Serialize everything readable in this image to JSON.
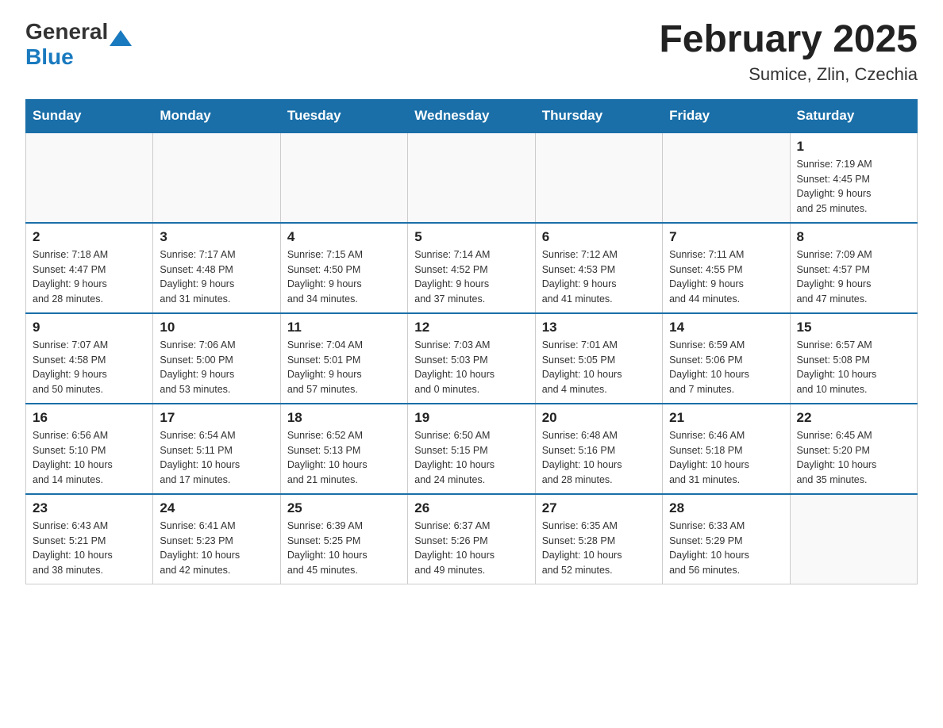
{
  "logo": {
    "general": "General",
    "blue": "Blue"
  },
  "title": "February 2025",
  "subtitle": "Sumice, Zlin, Czechia",
  "calendar": {
    "headers": [
      "Sunday",
      "Monday",
      "Tuesday",
      "Wednesday",
      "Thursday",
      "Friday",
      "Saturday"
    ],
    "weeks": [
      [
        {
          "day": "",
          "info": ""
        },
        {
          "day": "",
          "info": ""
        },
        {
          "day": "",
          "info": ""
        },
        {
          "day": "",
          "info": ""
        },
        {
          "day": "",
          "info": ""
        },
        {
          "day": "",
          "info": ""
        },
        {
          "day": "1",
          "info": "Sunrise: 7:19 AM\nSunset: 4:45 PM\nDaylight: 9 hours\nand 25 minutes."
        }
      ],
      [
        {
          "day": "2",
          "info": "Sunrise: 7:18 AM\nSunset: 4:47 PM\nDaylight: 9 hours\nand 28 minutes."
        },
        {
          "day": "3",
          "info": "Sunrise: 7:17 AM\nSunset: 4:48 PM\nDaylight: 9 hours\nand 31 minutes."
        },
        {
          "day": "4",
          "info": "Sunrise: 7:15 AM\nSunset: 4:50 PM\nDaylight: 9 hours\nand 34 minutes."
        },
        {
          "day": "5",
          "info": "Sunrise: 7:14 AM\nSunset: 4:52 PM\nDaylight: 9 hours\nand 37 minutes."
        },
        {
          "day": "6",
          "info": "Sunrise: 7:12 AM\nSunset: 4:53 PM\nDaylight: 9 hours\nand 41 minutes."
        },
        {
          "day": "7",
          "info": "Sunrise: 7:11 AM\nSunset: 4:55 PM\nDaylight: 9 hours\nand 44 minutes."
        },
        {
          "day": "8",
          "info": "Sunrise: 7:09 AM\nSunset: 4:57 PM\nDaylight: 9 hours\nand 47 minutes."
        }
      ],
      [
        {
          "day": "9",
          "info": "Sunrise: 7:07 AM\nSunset: 4:58 PM\nDaylight: 9 hours\nand 50 minutes."
        },
        {
          "day": "10",
          "info": "Sunrise: 7:06 AM\nSunset: 5:00 PM\nDaylight: 9 hours\nand 53 minutes."
        },
        {
          "day": "11",
          "info": "Sunrise: 7:04 AM\nSunset: 5:01 PM\nDaylight: 9 hours\nand 57 minutes."
        },
        {
          "day": "12",
          "info": "Sunrise: 7:03 AM\nSunset: 5:03 PM\nDaylight: 10 hours\nand 0 minutes."
        },
        {
          "day": "13",
          "info": "Sunrise: 7:01 AM\nSunset: 5:05 PM\nDaylight: 10 hours\nand 4 minutes."
        },
        {
          "day": "14",
          "info": "Sunrise: 6:59 AM\nSunset: 5:06 PM\nDaylight: 10 hours\nand 7 minutes."
        },
        {
          "day": "15",
          "info": "Sunrise: 6:57 AM\nSunset: 5:08 PM\nDaylight: 10 hours\nand 10 minutes."
        }
      ],
      [
        {
          "day": "16",
          "info": "Sunrise: 6:56 AM\nSunset: 5:10 PM\nDaylight: 10 hours\nand 14 minutes."
        },
        {
          "day": "17",
          "info": "Sunrise: 6:54 AM\nSunset: 5:11 PM\nDaylight: 10 hours\nand 17 minutes."
        },
        {
          "day": "18",
          "info": "Sunrise: 6:52 AM\nSunset: 5:13 PM\nDaylight: 10 hours\nand 21 minutes."
        },
        {
          "day": "19",
          "info": "Sunrise: 6:50 AM\nSunset: 5:15 PM\nDaylight: 10 hours\nand 24 minutes."
        },
        {
          "day": "20",
          "info": "Sunrise: 6:48 AM\nSunset: 5:16 PM\nDaylight: 10 hours\nand 28 minutes."
        },
        {
          "day": "21",
          "info": "Sunrise: 6:46 AM\nSunset: 5:18 PM\nDaylight: 10 hours\nand 31 minutes."
        },
        {
          "day": "22",
          "info": "Sunrise: 6:45 AM\nSunset: 5:20 PM\nDaylight: 10 hours\nand 35 minutes."
        }
      ],
      [
        {
          "day": "23",
          "info": "Sunrise: 6:43 AM\nSunset: 5:21 PM\nDaylight: 10 hours\nand 38 minutes."
        },
        {
          "day": "24",
          "info": "Sunrise: 6:41 AM\nSunset: 5:23 PM\nDaylight: 10 hours\nand 42 minutes."
        },
        {
          "day": "25",
          "info": "Sunrise: 6:39 AM\nSunset: 5:25 PM\nDaylight: 10 hours\nand 45 minutes."
        },
        {
          "day": "26",
          "info": "Sunrise: 6:37 AM\nSunset: 5:26 PM\nDaylight: 10 hours\nand 49 minutes."
        },
        {
          "day": "27",
          "info": "Sunrise: 6:35 AM\nSunset: 5:28 PM\nDaylight: 10 hours\nand 52 minutes."
        },
        {
          "day": "28",
          "info": "Sunrise: 6:33 AM\nSunset: 5:29 PM\nDaylight: 10 hours\nand 56 minutes."
        },
        {
          "day": "",
          "info": ""
        }
      ]
    ]
  }
}
